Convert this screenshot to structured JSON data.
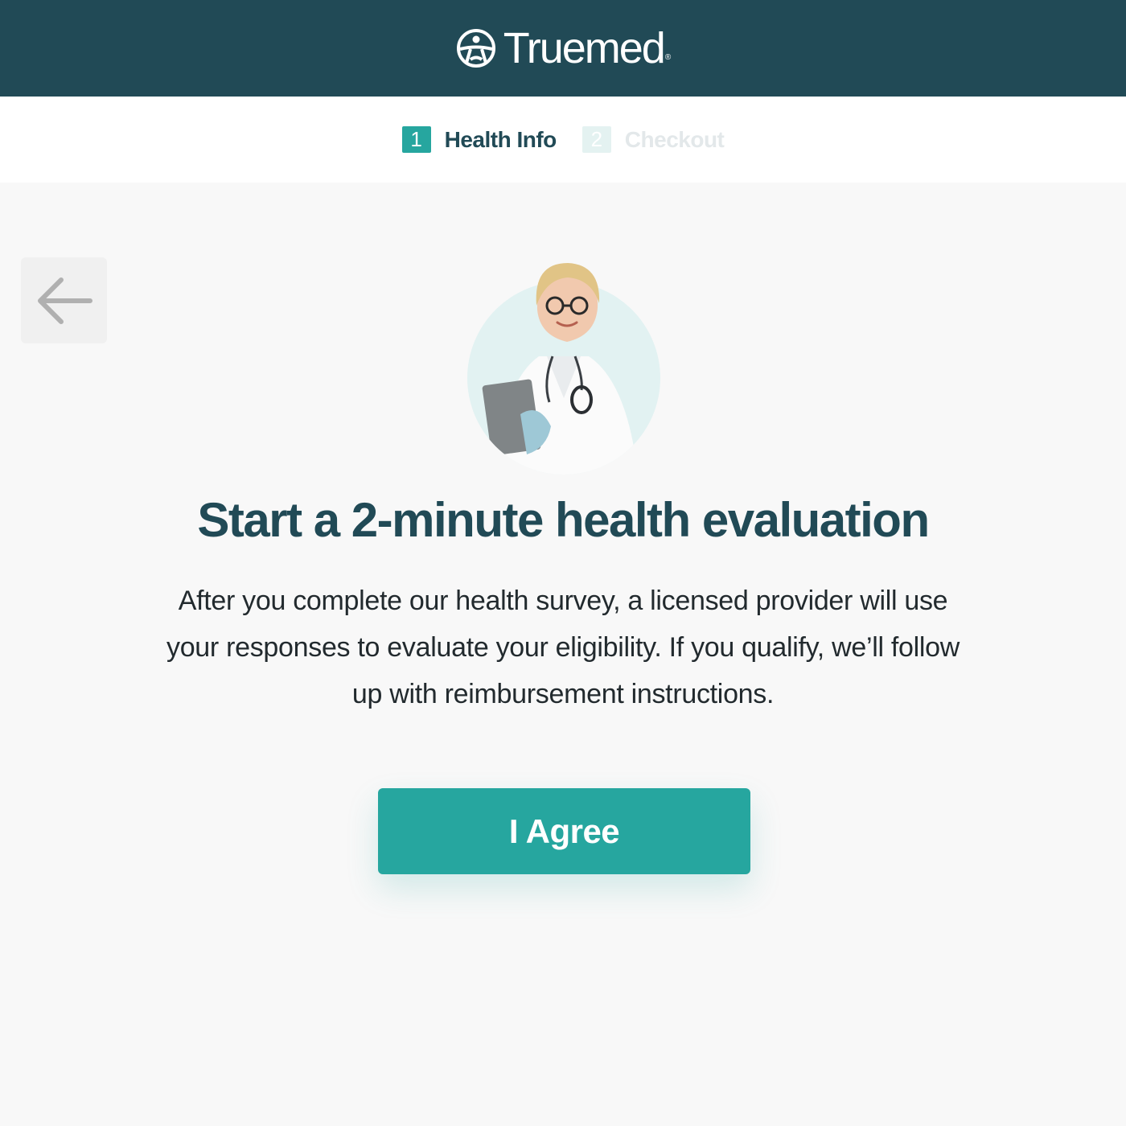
{
  "header": {
    "brand_name": "Truemed",
    "brand_mark": "®",
    "logo_icon": "person-circle-logo-icon",
    "background_color": "#214a56"
  },
  "steps": [
    {
      "number": "1",
      "label": "Health Info",
      "state": "active"
    },
    {
      "number": "2",
      "label": "Checkout",
      "state": "inactive"
    }
  ],
  "nav": {
    "back_icon": "arrow-left-icon"
  },
  "main": {
    "avatar": "doctor-avatar",
    "title": "Start a 2-minute health evaluation",
    "description": "After you complete our health survey, a licensed provider will use your responses to evaluate your eligibility. If you qualify, we’ll follow up with reimbursement instructions.",
    "agree_label": "I Agree"
  },
  "colors": {
    "accent": "#26a69f",
    "dark": "#214a56",
    "background": "#f8f8f8"
  }
}
